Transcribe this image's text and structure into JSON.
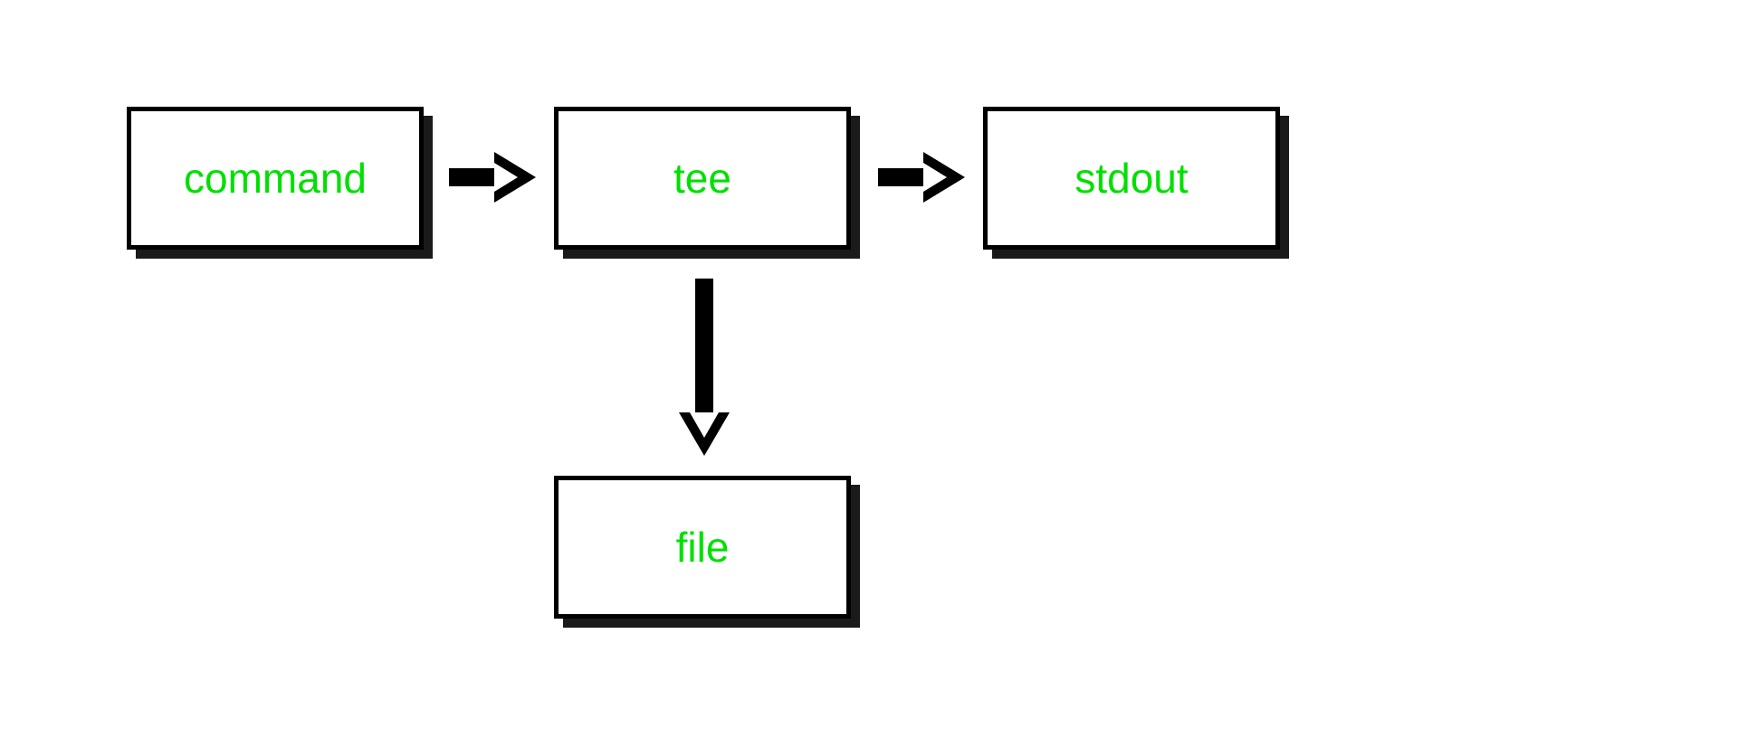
{
  "diagram": {
    "nodes": {
      "command": {
        "label": "command"
      },
      "tee": {
        "label": "tee"
      },
      "stdout": {
        "label": "stdout"
      },
      "file": {
        "label": "file"
      }
    },
    "edges": [
      {
        "from": "command",
        "to": "tee",
        "direction": "right"
      },
      {
        "from": "tee",
        "to": "stdout",
        "direction": "right"
      },
      {
        "from": "tee",
        "to": "file",
        "direction": "down"
      }
    ],
    "style": {
      "label_color": "#00e000",
      "border_color": "#000000",
      "shadow_color": "#1a1a1a",
      "background": "#ffffff"
    }
  }
}
